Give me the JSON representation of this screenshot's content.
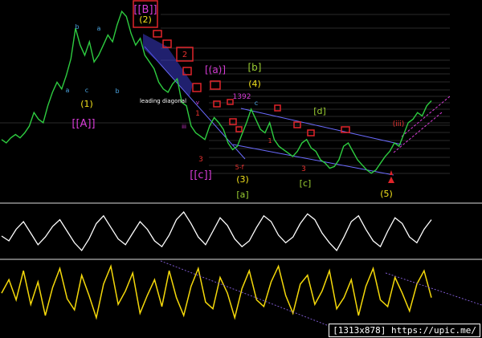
{
  "chart_data": [
    {
      "type": "line",
      "panel": "price",
      "series": [
        {
          "values": [
            62,
            60,
            63,
            65,
            63,
            66,
            70,
            78,
            74,
            72,
            82,
            90,
            96,
            92,
            100,
            110,
            128,
            118,
            112,
            120,
            108,
            112,
            118,
            124,
            120,
            130,
            138,
            135,
            125,
            118,
            122,
            112,
            108,
            104,
            96,
            92,
            90,
            95,
            98,
            84,
            82,
            70,
            66,
            64,
            62,
            70,
            75,
            72,
            68,
            60,
            56,
            58,
            65,
            72,
            80,
            74,
            68,
            66,
            72,
            62,
            58,
            56,
            54,
            52,
            55,
            60,
            62,
            57,
            55,
            50,
            48,
            45,
            46,
            50,
            58,
            60,
            55,
            50,
            47,
            44,
            42,
            44,
            48,
            52,
            55,
            60,
            58,
            65,
            72,
            74,
            78,
            76,
            82,
            85
          ]
        }
      ],
      "colors": {
        "price": "#2ecc40",
        "fib_levels": "#555555",
        "channel": "#6b6bff",
        "wave_minor": "#4aa3df",
        "wave_red": "#e8312f",
        "wave_yellow": "#f2e11b",
        "wave_magenta": "#d63cd6",
        "wave_green": "#9acd32",
        "box": "#e0242a"
      },
      "annotations": {
        "wave_top": "[[B]]",
        "wave_2": "(2)",
        "wave_1": "(1)",
        "wave_A": "[[A]]",
        "wave_a_paren": "[(a)]",
        "wave_b": "[b]",
        "wave_4": "(4)",
        "level_1392": "1392",
        "leading_diagonal": "leading diagonal",
        "wave_d": "[d]",
        "wave_iii": "(iii)",
        "wave_c_double": "[[c]]",
        "wave_3": "(3)",
        "wave_a": "[a]",
        "wave_c": "[c]",
        "wave_5": "(5)",
        "wave_5f": "5-f",
        "red_1": "1",
        "red_3": "3",
        "red_3b": "3",
        "red_5": "5",
        "red_1b": "1",
        "red_2": "2",
        "minor_a": "a",
        "minor_b": "b",
        "minor_c": "c",
        "minor_iii": "iii",
        "minor_v": "v"
      }
    },
    {
      "type": "line",
      "panel": "oscillator-1",
      "series": [
        {
          "values": [
            45,
            40,
            52,
            60,
            48,
            36,
            44,
            55,
            62,
            50,
            38,
            30,
            42,
            58,
            66,
            54,
            42,
            36,
            48,
            60,
            52,
            40,
            34,
            46,
            62,
            70,
            58,
            44,
            36,
            50,
            64,
            56,
            42,
            34,
            40,
            54,
            66,
            60,
            46,
            38,
            44,
            58,
            68,
            62,
            48,
            38,
            30,
            44,
            60,
            66,
            52,
            40,
            34,
            50,
            64,
            58,
            44,
            38,
            52,
            62
          ]
        }
      ],
      "colors": {
        "line": "#ffffff"
      }
    },
    {
      "type": "line",
      "panel": "oscillator-2",
      "series": [
        {
          "values": [
            50,
            62,
            44,
            70,
            40,
            60,
            30,
            55,
            72,
            45,
            35,
            66,
            48,
            28,
            58,
            74,
            40,
            52,
            68,
            32,
            48,
            62,
            38,
            70,
            46,
            30,
            56,
            72,
            42,
            36,
            64,
            50,
            28,
            54,
            70,
            44,
            38,
            60,
            74,
            48,
            32,
            58,
            66,
            40,
            52,
            70,
            36,
            46,
            62,
            30,
            56,
            72,
            44,
            38,
            64,
            50,
            34,
            58,
            70,
            46
          ]
        }
      ],
      "colors": {
        "line": "#f5d90a"
      }
    }
  ],
  "watermark": "[1313x878] https://upic.me/"
}
